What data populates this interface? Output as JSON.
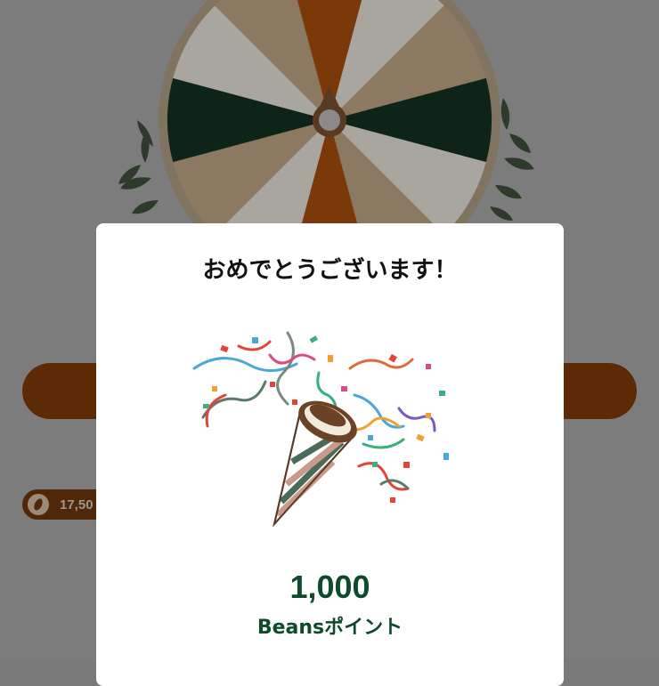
{
  "background": {
    "beans_balance": "17,50",
    "coin_icon": "coffee-bean-icon",
    "wheel_colors": {
      "dark_green": "#0e2418",
      "orange": "#7b3809",
      "tan": "#8c7962",
      "light": "#a9a59f",
      "frame": "#807461"
    },
    "spin_bar_color": "#5c2a05"
  },
  "modal": {
    "title": "おめでとうございます！",
    "illustration": "party-popper-icon",
    "reward_amount": "1,000",
    "reward_unit": "Beansポイント",
    "accent_color": "#0f4a2c"
  }
}
